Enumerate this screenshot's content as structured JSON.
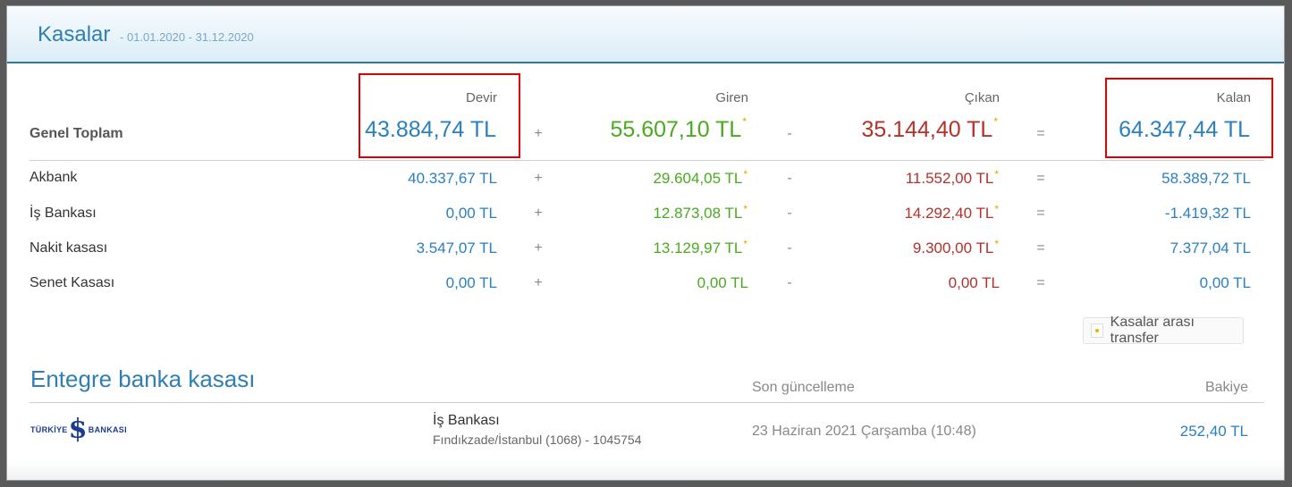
{
  "header": {
    "title": "Kasalar",
    "period": "- 01.01.2020 - 31.12.2020"
  },
  "columns": {
    "devir": "Devir",
    "giren": "Giren",
    "cikan": "Çıkan",
    "kalan": "Kalan"
  },
  "operators": {
    "plus": "+",
    "minus": "-",
    "equals": "="
  },
  "total": {
    "label": "Genel Toplam",
    "devir": "43.884,74 TL",
    "giren": "55.607,10 TL",
    "cikan": "35.144,40 TL",
    "kalan": "64.347,44 TL"
  },
  "rows": [
    {
      "label": "Akbank",
      "devir": "40.337,67 TL",
      "giren": "29.604,05 TL",
      "cikan": "11.552,00 TL",
      "kalan": "58.389,72 TL"
    },
    {
      "label": "İş Bankası",
      "devir": "0,00 TL",
      "giren": "12.873,08 TL",
      "cikan": "14.292,40 TL",
      "kalan": "-1.419,32 TL"
    },
    {
      "label": "Nakit kasası",
      "devir": "3.547,07 TL",
      "giren": "13.129,97 TL",
      "cikan": "9.300,00 TL",
      "kalan": "7.377,04 TL"
    },
    {
      "label": "Senet Kasası",
      "devir": "0,00 TL",
      "giren": "0,00 TL",
      "cikan": "0,00 TL",
      "kalan": "0,00 TL"
    }
  ],
  "star": "*",
  "transfer_button": "Kasalar arası transfer",
  "integrated": {
    "title": "Entegre banka kasası",
    "col_updated": "Son güncelleme",
    "col_balance": "Bakiye",
    "bank": {
      "logo_left": "TÜRKİYE",
      "logo_mark": "$",
      "logo_right": "BANKASI",
      "name": "İş Bankası",
      "branch": "Fındıkzade/İstanbul (1068) - 1045754",
      "updated": "23 Haziran 2021 Çarşamba (10:48)",
      "balance": "252,40 TL"
    }
  },
  "colors": {
    "blue": "#2a7fc0",
    "green": "#4aaa1f",
    "red": "#b3312b",
    "highlight": "#e00000"
  }
}
